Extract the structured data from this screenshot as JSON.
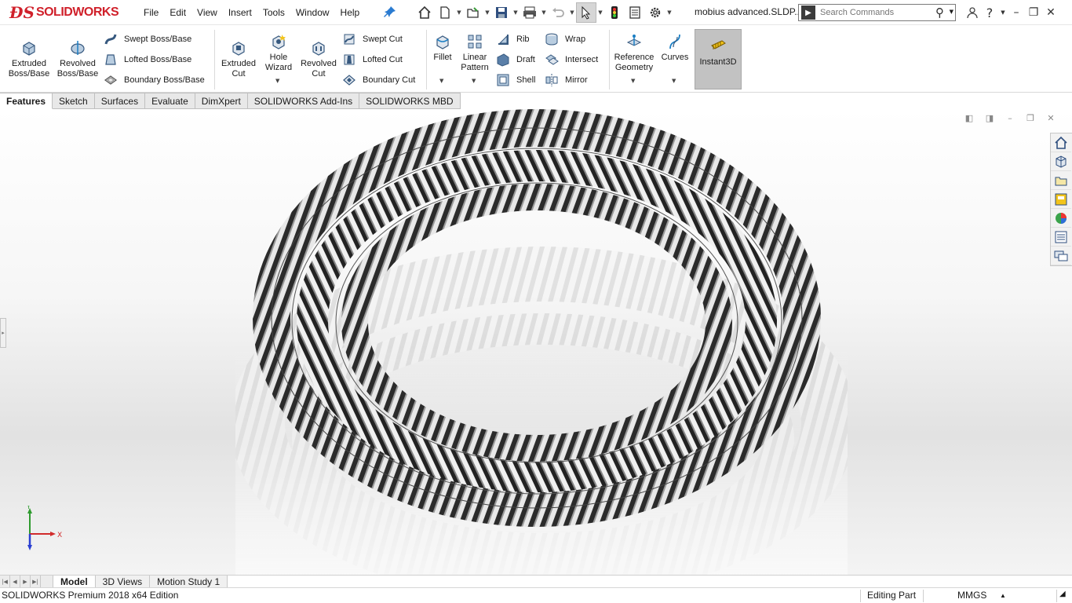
{
  "app": {
    "brand": "SOLIDWORKS",
    "file_title": "mobius advanced.SLDP..."
  },
  "menu": [
    "File",
    "Edit",
    "View",
    "Insert",
    "Tools",
    "Window",
    "Help"
  ],
  "search": {
    "placeholder": "Search Commands"
  },
  "ribbon": {
    "extruded_boss": "Extruded\nBoss/Base",
    "revolved_boss": "Revolved\nBoss/Base",
    "swept_boss": "Swept Boss/Base",
    "lofted_boss": "Lofted Boss/Base",
    "boundary_boss": "Boundary Boss/Base",
    "extruded_cut": "Extruded\nCut",
    "hole_wizard": "Hole\nWizard",
    "revolved_cut": "Revolved\nCut",
    "swept_cut": "Swept Cut",
    "lofted_cut": "Lofted Cut",
    "boundary_cut": "Boundary Cut",
    "fillet": "Fillet",
    "linear_pattern": "Linear\nPattern",
    "rib": "Rib",
    "draft": "Draft",
    "shell": "Shell",
    "wrap": "Wrap",
    "intersect": "Intersect",
    "mirror": "Mirror",
    "reference_geometry": "Reference\nGeometry",
    "curves": "Curves",
    "instant3d": "Instant3D"
  },
  "cm_tabs": [
    "Features",
    "Sketch",
    "Surfaces",
    "Evaluate",
    "DimXpert",
    "SOLIDWORKS Add-Ins",
    "SOLIDWORKS MBD"
  ],
  "triad": {
    "x_label": "X",
    "y_label": "Y"
  },
  "bottom_tabs": [
    "Model",
    "3D Views",
    "Motion Study 1"
  ],
  "status": {
    "edition": "SOLIDWORKS Premium 2018 x64 Edition",
    "mode": "Editing Part",
    "units": "MMGS"
  },
  "colors": {
    "brand_red": "#d0202a",
    "accent_blue": "#2a7bd1",
    "tab_active_bg": "#ffffff"
  }
}
